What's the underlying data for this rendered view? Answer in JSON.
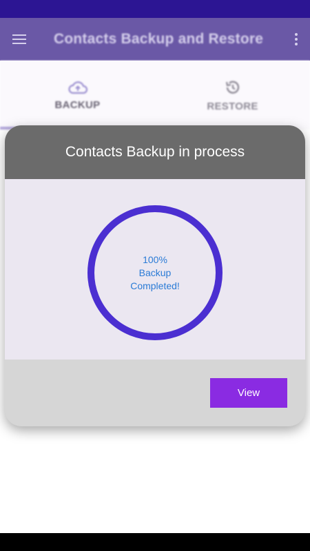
{
  "app_bar": {
    "title": "Contacts Backup and Restore"
  },
  "tabs": [
    {
      "label": "BACKUP",
      "icon": "cloud-upload-icon",
      "active": true
    },
    {
      "label": "RESTORE",
      "icon": "restore-icon",
      "active": false
    }
  ],
  "dialog": {
    "title": "Contacts Backup in process",
    "progress": {
      "percent_text": "100%",
      "line1": "Backup",
      "line2": "Completed!",
      "value": 1.0
    },
    "view_button": "View"
  },
  "colors": {
    "status_bar": "#2c1593",
    "app_bar": "#6a58a6",
    "ring": "#4b2fd1",
    "progress_text": "#2a7bd6",
    "view_button": "#8a2be2",
    "dialog_header": "#6b6b6b",
    "dialog_body": "#ebe7f1",
    "dialog_footer": "#d6d6d6"
  }
}
